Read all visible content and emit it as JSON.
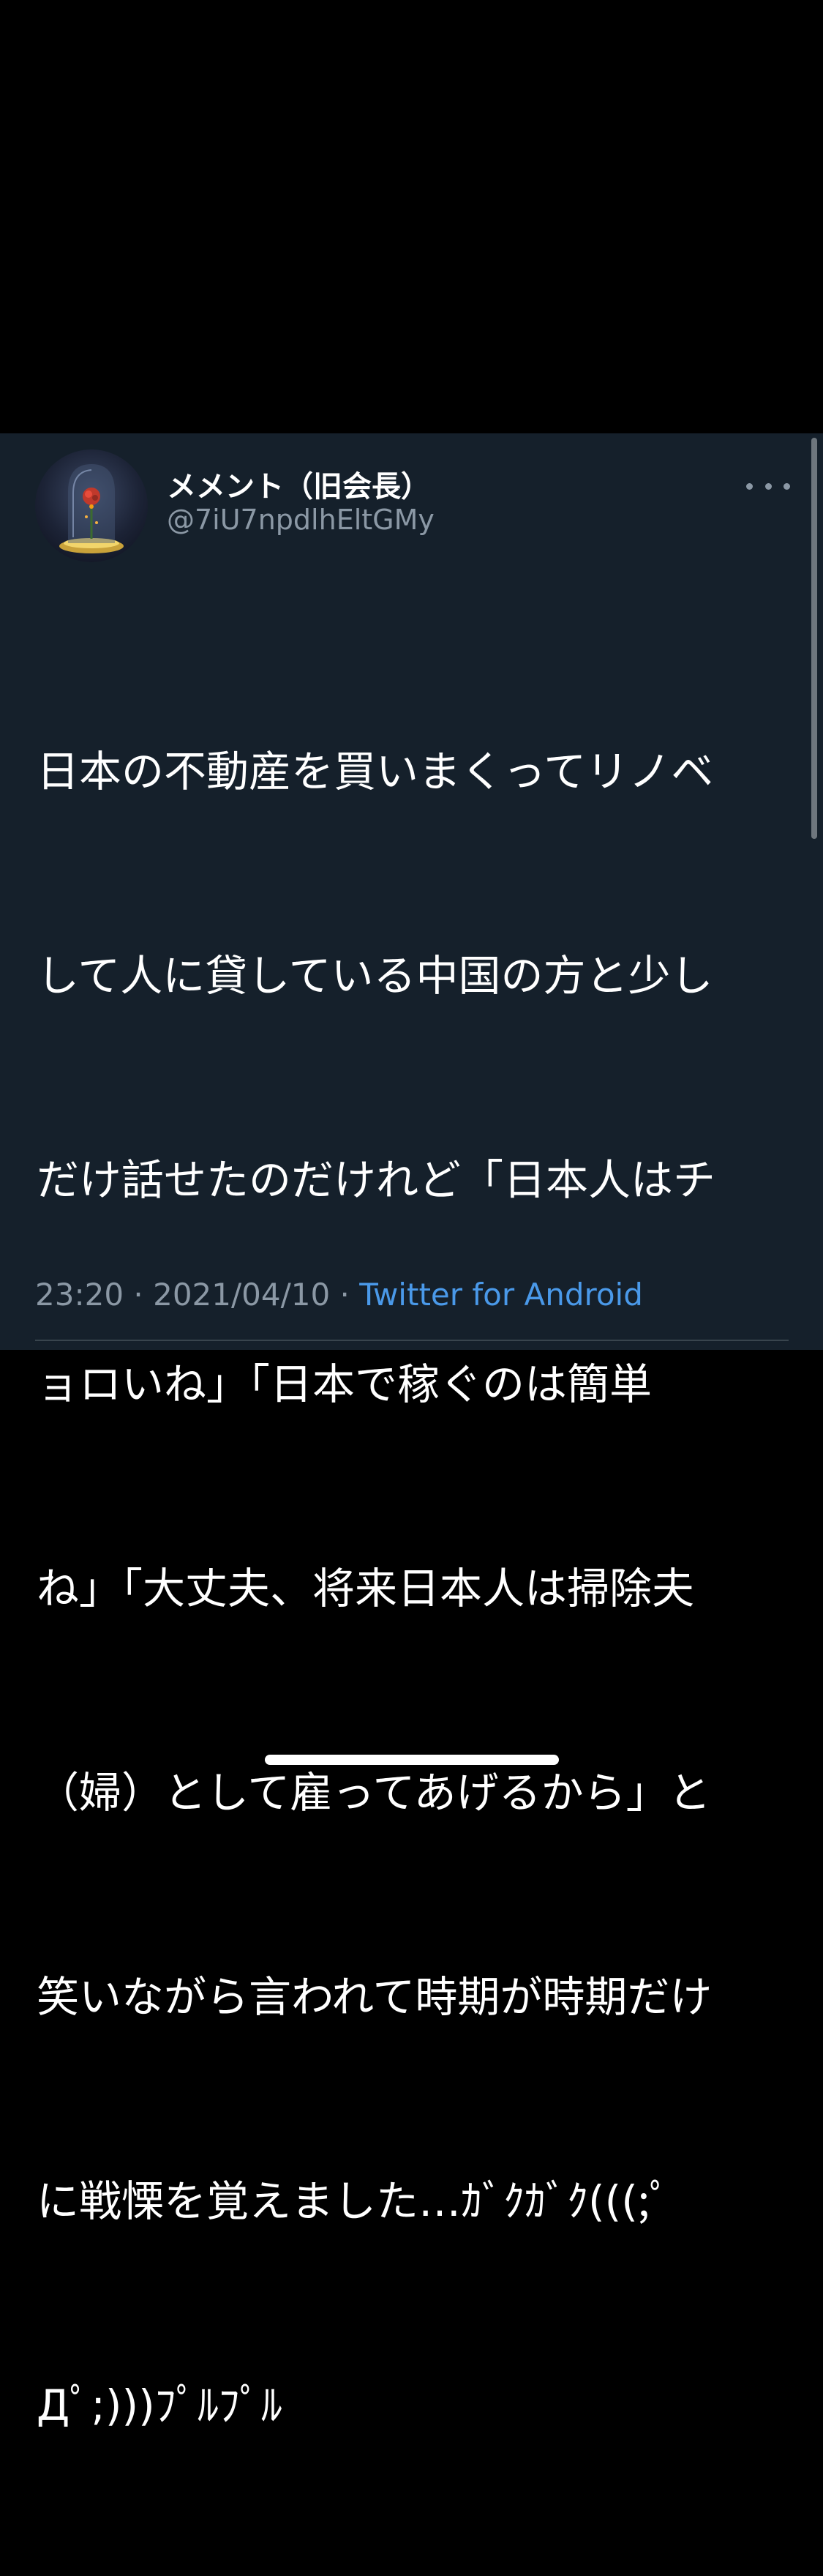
{
  "tweet": {
    "author": {
      "display_name": "メメント（旧会長）",
      "handle": "@7iU7npdlhEltGMy",
      "avatar_icon": "bell-jar-rose-avatar"
    },
    "more_icon": "more-horizontal-icon",
    "text_lines": [
      "日本の不動産を買いまくってリノベ",
      "して人に貸している中国の方と少し",
      "だけ話せたのだけれど「日本人はチ",
      "ョロいね」「日本で稼ぐのは簡単",
      "ね」「大丈夫、将来日本人は掃除夫",
      "（婦）として雇ってあげるから」と",
      "笑いながら言われて時期が時期だけ",
      "に戦慄を覚えました…ｶﾞｸｶﾞｸ(((;ﾟ",
      "Дﾟ;)))ﾌﾟﾙﾌﾟﾙ"
    ],
    "time": "23:20",
    "separator": " · ",
    "date": "2021/04/10",
    "source": "Twitter for Android"
  },
  "colors": {
    "background": "#000000",
    "card_background": "#15202b",
    "text_primary": "#ffffff",
    "text_secondary": "#8b98a5",
    "link": "#4a99e9"
  }
}
